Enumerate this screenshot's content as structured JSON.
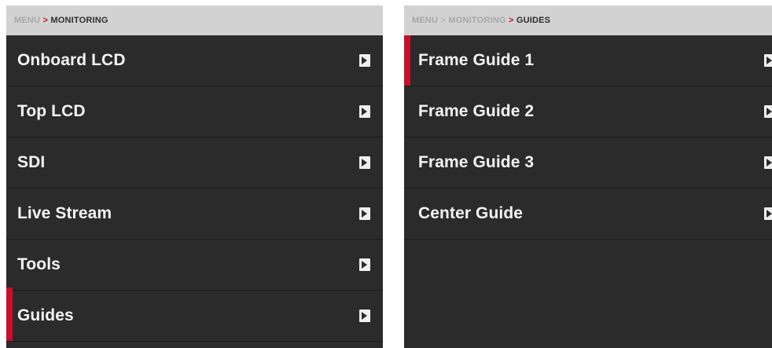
{
  "left_panel": {
    "breadcrumb": {
      "root": "MENU",
      "separator": ">",
      "current": "MONITORING"
    },
    "items": [
      {
        "label": "Onboard LCD",
        "selected": false
      },
      {
        "label": "Top LCD",
        "selected": false
      },
      {
        "label": "SDI",
        "selected": false
      },
      {
        "label": "Live Stream",
        "selected": false
      },
      {
        "label": "Tools",
        "selected": false
      },
      {
        "label": "Guides",
        "selected": true
      }
    ]
  },
  "right_panel": {
    "breadcrumb": {
      "root": "MENU",
      "separator1": ">",
      "parent": "MONITORING",
      "separator2": ">",
      "current": "GUIDES"
    },
    "items": [
      {
        "label": "Frame Guide 1",
        "selected": true
      },
      {
        "label": "Frame Guide 2",
        "selected": false
      },
      {
        "label": "Frame Guide 3",
        "selected": false
      },
      {
        "label": "Center Guide",
        "selected": false
      }
    ]
  },
  "colors": {
    "background": "#2b2b2b",
    "breadcrumb_bg": "#d2d2d2",
    "accent": "#c8102e",
    "text": "#f4f4f4"
  },
  "icons": {
    "row_arrow": "chevron-right-icon"
  }
}
